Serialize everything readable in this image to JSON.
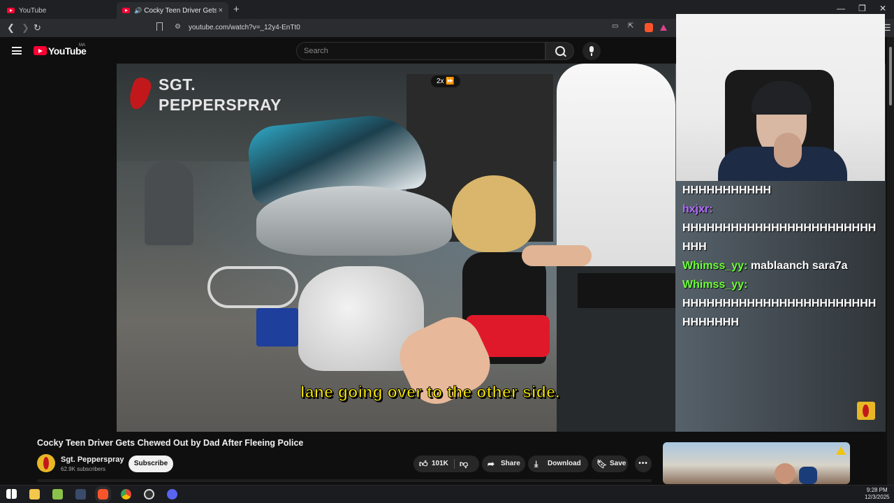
{
  "browser": {
    "tabs": [
      {
        "title": "YouTube"
      },
      {
        "title": "Cocky Teen Driver Gets Chew"
      }
    ],
    "new_tab": "+",
    "window_controls": {
      "minimize": "—",
      "restore": "❐",
      "close": "✕"
    },
    "url": "youtube.com/watch?v=_12y4-EnTt0",
    "nav": {
      "back": "❮",
      "forward": "❯",
      "reload": "↻"
    }
  },
  "youtube": {
    "logo_text": "YouTube",
    "country_code": "MA",
    "search_placeholder": "Search"
  },
  "video": {
    "watermark": "SGT.\nPEPPERSPRAY",
    "playback_speed": "2x ⏩",
    "caption": "lane going over to the other side."
  },
  "chat": {
    "messages": [
      {
        "user": "",
        "text": "HHHHHHHHHHH"
      },
      {
        "user": "hxjxr:",
        "text": ""
      },
      {
        "user": "",
        "text": "HHHHHHHHHHHHHHHHHHHHHHHHHHH"
      },
      {
        "user": "Whimss_yy:",
        "text": "mablaanch sara7a"
      },
      {
        "user": "Whimss_yy:",
        "text": ""
      },
      {
        "user": "",
        "text": "HHHHHHHHHHHHHHHHHHHHHHHHHHHHHHH"
      }
    ]
  },
  "watch": {
    "title": "Cocky Teen Driver Gets Chewed Out by Dad After Fleeing Police",
    "channel_name": "Sgt. Pepperspray",
    "subscribers": "62.9K subscribers",
    "subscribe_label": "Subscribe",
    "likes": "101K",
    "share_label": "Share",
    "download_label": "Download",
    "save_label": "Save",
    "more_label": "•••"
  },
  "taskbar": {
    "time": "9:28 PM",
    "date": "12/3/2025"
  },
  "colors": {
    "youtube_red": "#ff0033",
    "caption_yellow": "#f5e600",
    "chat_purple": "#b36bff",
    "chat_green": "#6eff3a"
  }
}
